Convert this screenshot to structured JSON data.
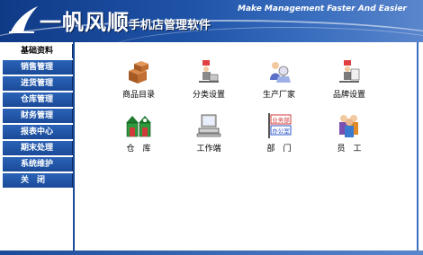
{
  "header": {
    "title": "一帆风顺",
    "subtitle": "手机店管理软件",
    "slogan": "Make Management Faster And Easier"
  },
  "sidebar": {
    "items": [
      {
        "label": "基础资料",
        "active": true
      },
      {
        "label": "销售管理",
        "active": false
      },
      {
        "label": "进货管理",
        "active": false
      },
      {
        "label": "仓库管理",
        "active": false
      },
      {
        "label": "财务管理",
        "active": false
      },
      {
        "label": "报表中心",
        "active": false
      },
      {
        "label": "期末处理",
        "active": false
      },
      {
        "label": "系统维护",
        "active": false
      },
      {
        "label": "关　闭",
        "active": false
      }
    ]
  },
  "main": {
    "tiles": [
      {
        "label": "商品目录",
        "icon": "boxes-icon"
      },
      {
        "label": "分类设置",
        "icon": "classify-icon"
      },
      {
        "label": "生产厂家",
        "icon": "manufacturer-icon"
      },
      {
        "label": "品牌设置",
        "icon": "brand-icon"
      },
      {
        "label": "仓　库",
        "icon": "warehouse-icon"
      },
      {
        "label": "工作端",
        "icon": "workstation-icon"
      },
      {
        "label": "部　门",
        "icon": "department-icon"
      },
      {
        "label": "员　工",
        "icon": "employees-icon"
      }
    ],
    "department_signs": [
      "业务部",
      "办公室"
    ]
  },
  "colors": {
    "banner": "#1f53a8",
    "nav": "#1b4a98",
    "background": "#ffffff"
  }
}
